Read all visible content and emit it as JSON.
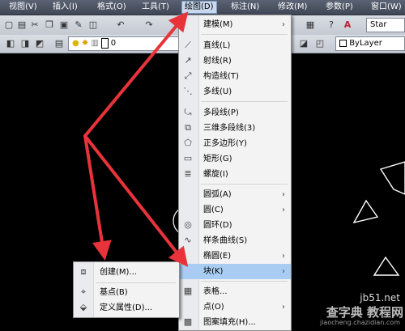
{
  "menubar": {
    "items": [
      {
        "label": "视图(V)"
      },
      {
        "label": "插入(I)"
      },
      {
        "label": "格式(O)"
      },
      {
        "label": "工具(T)"
      },
      {
        "label": "绘图(D)"
      },
      {
        "label": "标注(N)"
      },
      {
        "label": "修改(M)"
      },
      {
        "label": "参数(P)"
      },
      {
        "label": "窗口(W)"
      }
    ]
  },
  "toolbar": {
    "style_combo": "Star",
    "layer_value": "0",
    "linetype_combo": "ByLayer"
  },
  "draw_menu": {
    "items": [
      {
        "label": "建模(M)",
        "icon": "none",
        "submenu": true
      },
      {
        "label": "直线(L)",
        "icon": "line-icon"
      },
      {
        "label": "射线(R)",
        "icon": "ray-icon"
      },
      {
        "label": "构造线(T)",
        "icon": "xline-icon"
      },
      {
        "label": "多线(U)",
        "icon": "mline-icon"
      },
      {
        "label": "多段线(P)",
        "icon": "polyline-icon"
      },
      {
        "label": "三维多段线(3)",
        "icon": "3dpoly-icon"
      },
      {
        "label": "正多边形(Y)",
        "icon": "polygon-icon"
      },
      {
        "label": "矩形(G)",
        "icon": "rectangle-icon"
      },
      {
        "label": "螺旋(I)",
        "icon": "helix-icon"
      },
      {
        "label": "圆弧(A)",
        "icon": "none",
        "submenu": true
      },
      {
        "label": "圆(C)",
        "icon": "none",
        "submenu": true
      },
      {
        "label": "圆环(D)",
        "icon": "donut-icon"
      },
      {
        "label": "样条曲线(S)",
        "icon": "spline-icon"
      },
      {
        "label": "椭圆(E)",
        "icon": "none",
        "submenu": true
      },
      {
        "label": "块(K)",
        "icon": "none",
        "submenu": true,
        "highlighted": true
      },
      {
        "label": "表格...",
        "icon": "table-icon"
      },
      {
        "label": "点(O)",
        "icon": "none",
        "submenu": true
      },
      {
        "label": "图案填充(H)...",
        "icon": "hatch-icon"
      }
    ]
  },
  "block_submenu": {
    "items": [
      {
        "label": "创建(M)...",
        "icon": "create-block-icon"
      },
      {
        "label": "基点(B)",
        "icon": "base-point-icon"
      },
      {
        "label": "定义属性(D)...",
        "icon": "define-attribute-icon"
      }
    ]
  },
  "watermark": {
    "line1": "jb51.net",
    "line2": "查字典 教程网",
    "line3": "jiaocheng.chazidian.com"
  },
  "colors": {
    "menubar_bg": "#4a5161",
    "menu_highlight": "#a9cdf2",
    "arrow_red": "#e8333a",
    "canvas_bg": "#000000"
  }
}
